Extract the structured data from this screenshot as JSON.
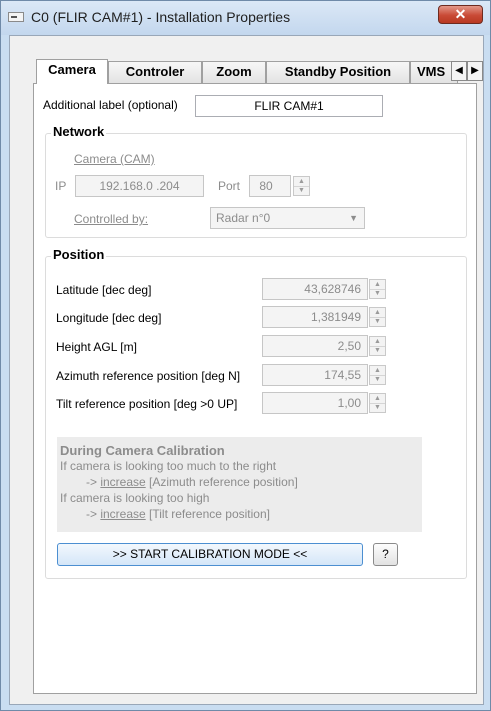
{
  "window": {
    "title": "C0 (FLIR CAM#1) - Installation Properties",
    "close_glyph": "✕",
    "app_icon": "app-window-icon"
  },
  "tabs": [
    {
      "label": "Camera",
      "active": true
    },
    {
      "label": "Controler",
      "active": false
    },
    {
      "label": "Zoom",
      "active": false
    },
    {
      "label": "Standby Position",
      "active": false
    },
    {
      "label": "VMS",
      "active": false
    }
  ],
  "tab_scroll": {
    "left": "◀",
    "right": "▶"
  },
  "additional_label": {
    "label": "Additional label (optional)",
    "value": "FLIR CAM#1"
  },
  "network": {
    "title": "Network",
    "camera_link": "Camera (CAM)",
    "ip_label": "IP",
    "ip_value": "192.168.0 .204",
    "port_label": "Port",
    "port_value": "80",
    "controlled_by_label": "Controlled by:",
    "controlled_by_value": "Radar n°0"
  },
  "position": {
    "title": "Position",
    "fields": [
      {
        "label": "Latitude [dec deg]",
        "value": "43,628746"
      },
      {
        "label": "Longitude [dec deg]",
        "value": "1,381949"
      },
      {
        "label": "Height AGL [m]",
        "value": "2,50"
      },
      {
        "label": "Azimuth reference position [deg N]",
        "value": "174,55"
      },
      {
        "label": "Tilt reference position [deg >0 UP]",
        "value": "1,00"
      }
    ]
  },
  "calibration": {
    "heading": "During Camera Calibration",
    "line1": "If camera is looking too much to the right",
    "line2_prefix": "-> ",
    "line2_link": "increase",
    "line2_suffix": " [Azimuth reference position]",
    "line3": "If camera is looking too high",
    "line4_prefix": "-> ",
    "line4_link": "increase",
    "line4_suffix": " [Tilt reference position]",
    "button_label": ">> START CALIBRATION MODE <<",
    "help_label": "?"
  },
  "colors": {
    "accent": "#4c8fd1",
    "close_button": "#c94a36",
    "disabled_text": "#8c8c8c"
  }
}
